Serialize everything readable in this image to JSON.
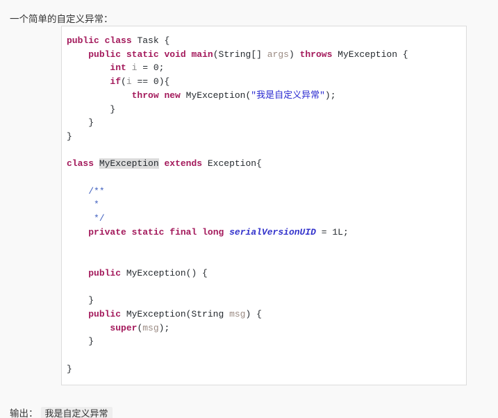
{
  "intro": {
    "text": "一个简单的自定义异常："
  },
  "code_block": {
    "language": "java",
    "lines": [
      [
        {
          "t": "public",
          "c": "kw"
        },
        {
          "t": " ",
          "c": "pun"
        },
        {
          "t": "class",
          "c": "kw"
        },
        {
          "t": " Task {",
          "c": "typ"
        }
      ],
      [
        {
          "t": "    ",
          "c": "pun"
        },
        {
          "t": "public",
          "c": "kw"
        },
        {
          "t": " ",
          "c": "pun"
        },
        {
          "t": "static",
          "c": "kw"
        },
        {
          "t": " ",
          "c": "pun"
        },
        {
          "t": "void",
          "c": "kw"
        },
        {
          "t": " ",
          "c": "pun"
        },
        {
          "t": "main",
          "c": "kw"
        },
        {
          "t": "(String[] ",
          "c": "typ"
        },
        {
          "t": "args",
          "c": "prm"
        },
        {
          "t": ") ",
          "c": "typ"
        },
        {
          "t": "throws",
          "c": "kw"
        },
        {
          "t": " MyException {",
          "c": "typ"
        }
      ],
      [
        {
          "t": "        ",
          "c": "pun"
        },
        {
          "t": "int",
          "c": "kw"
        },
        {
          "t": " ",
          "c": "pun"
        },
        {
          "t": "i",
          "c": "var"
        },
        {
          "t": " = ",
          "c": "typ"
        },
        {
          "t": "0",
          "c": "typ"
        },
        {
          "t": ";",
          "c": "typ"
        }
      ],
      [
        {
          "t": "        ",
          "c": "pun"
        },
        {
          "t": "if",
          "c": "kw"
        },
        {
          "t": "(",
          "c": "typ"
        },
        {
          "t": "i",
          "c": "var"
        },
        {
          "t": " == ",
          "c": "typ"
        },
        {
          "t": "0",
          "c": "typ"
        },
        {
          "t": "){",
          "c": "typ"
        }
      ],
      [
        {
          "t": "            ",
          "c": "pun"
        },
        {
          "t": "throw",
          "c": "kw"
        },
        {
          "t": " ",
          "c": "pun"
        },
        {
          "t": "new",
          "c": "kw"
        },
        {
          "t": " MyException(",
          "c": "typ"
        },
        {
          "t": "\"我是自定义异常\"",
          "c": "str"
        },
        {
          "t": ");",
          "c": "typ"
        }
      ],
      [
        {
          "t": "        }",
          "c": "typ"
        }
      ],
      [
        {
          "t": "    }",
          "c": "typ"
        }
      ],
      [
        {
          "t": "}",
          "c": "typ"
        }
      ],
      [],
      [
        {
          "t": "class",
          "c": "kw"
        },
        {
          "t": " ",
          "c": "pun"
        },
        {
          "t": "MyException",
          "c": "typ hl"
        },
        {
          "t": " ",
          "c": "pun"
        },
        {
          "t": "extends",
          "c": "kw"
        },
        {
          "t": " Exception{",
          "c": "typ"
        }
      ],
      [],
      [
        {
          "t": "    ",
          "c": "pun"
        },
        {
          "t": "/**",
          "c": "cmt"
        }
      ],
      [
        {
          "t": "     ",
          "c": "pun"
        },
        {
          "t": "*",
          "c": "cmt"
        }
      ],
      [
        {
          "t": "     ",
          "c": "pun"
        },
        {
          "t": "*/",
          "c": "cmt"
        }
      ],
      [
        {
          "t": "    ",
          "c": "pun"
        },
        {
          "t": "private",
          "c": "kw"
        },
        {
          "t": " ",
          "c": "pun"
        },
        {
          "t": "static",
          "c": "kw"
        },
        {
          "t": " ",
          "c": "pun"
        },
        {
          "t": "final",
          "c": "kw"
        },
        {
          "t": " ",
          "c": "pun"
        },
        {
          "t": "long",
          "c": "kw"
        },
        {
          "t": " ",
          "c": "pun"
        },
        {
          "t": "serialVersionUID",
          "c": "fld"
        },
        {
          "t": " = ",
          "c": "typ"
        },
        {
          "t": "1L",
          "c": "typ"
        },
        {
          "t": ";",
          "c": "typ"
        }
      ],
      [],
      [],
      [
        {
          "t": "    ",
          "c": "pun"
        },
        {
          "t": "public",
          "c": "kw"
        },
        {
          "t": " MyException() {",
          "c": "typ"
        }
      ],
      [],
      [
        {
          "t": "    }",
          "c": "typ"
        }
      ],
      [
        {
          "t": "    ",
          "c": "pun"
        },
        {
          "t": "public",
          "c": "kw"
        },
        {
          "t": " MyException(String ",
          "c": "typ"
        },
        {
          "t": "msg",
          "c": "prm"
        },
        {
          "t": ") {",
          "c": "typ"
        }
      ],
      [
        {
          "t": "        ",
          "c": "pun"
        },
        {
          "t": "super",
          "c": "kw"
        },
        {
          "t": "(",
          "c": "typ"
        },
        {
          "t": "msg",
          "c": "prm"
        },
        {
          "t": ");",
          "c": "typ"
        }
      ],
      [
        {
          "t": "    }",
          "c": "typ"
        }
      ],
      [],
      [
        {
          "t": "}",
          "c": "typ"
        }
      ]
    ],
    "plain_text": "public class Task {\n    public static void main(String[] args) throws MyException {\n        int i = 0;\n        if(i == 0){\n            throw new MyException(\"我是自定义异常\");\n        }\n    }\n}\n\nclass MyException extends Exception{\n\n    /**\n     *\n     */\n    private static final long serialVersionUID = 1L;\n\n\n    public MyException() {\n\n    }\n    public MyException(String msg) {\n        super(msg);\n    }\n\n}"
  },
  "output": {
    "label": "输出：",
    "value": "我是自定义异常"
  },
  "colors": {
    "page_background": "#f9f9f9",
    "code_background": "#ffffff",
    "code_border": "#dcdcdc",
    "keyword": "#a3195b",
    "string": "#2a2ad0",
    "comment": "#3f5fbf",
    "field": "#3333cc",
    "variable": "#8a8a8a",
    "parameter": "#9b8b83",
    "text": "#24292e",
    "highlight": "#dcdcdc",
    "inline_code_background": "#eeeeee"
  }
}
